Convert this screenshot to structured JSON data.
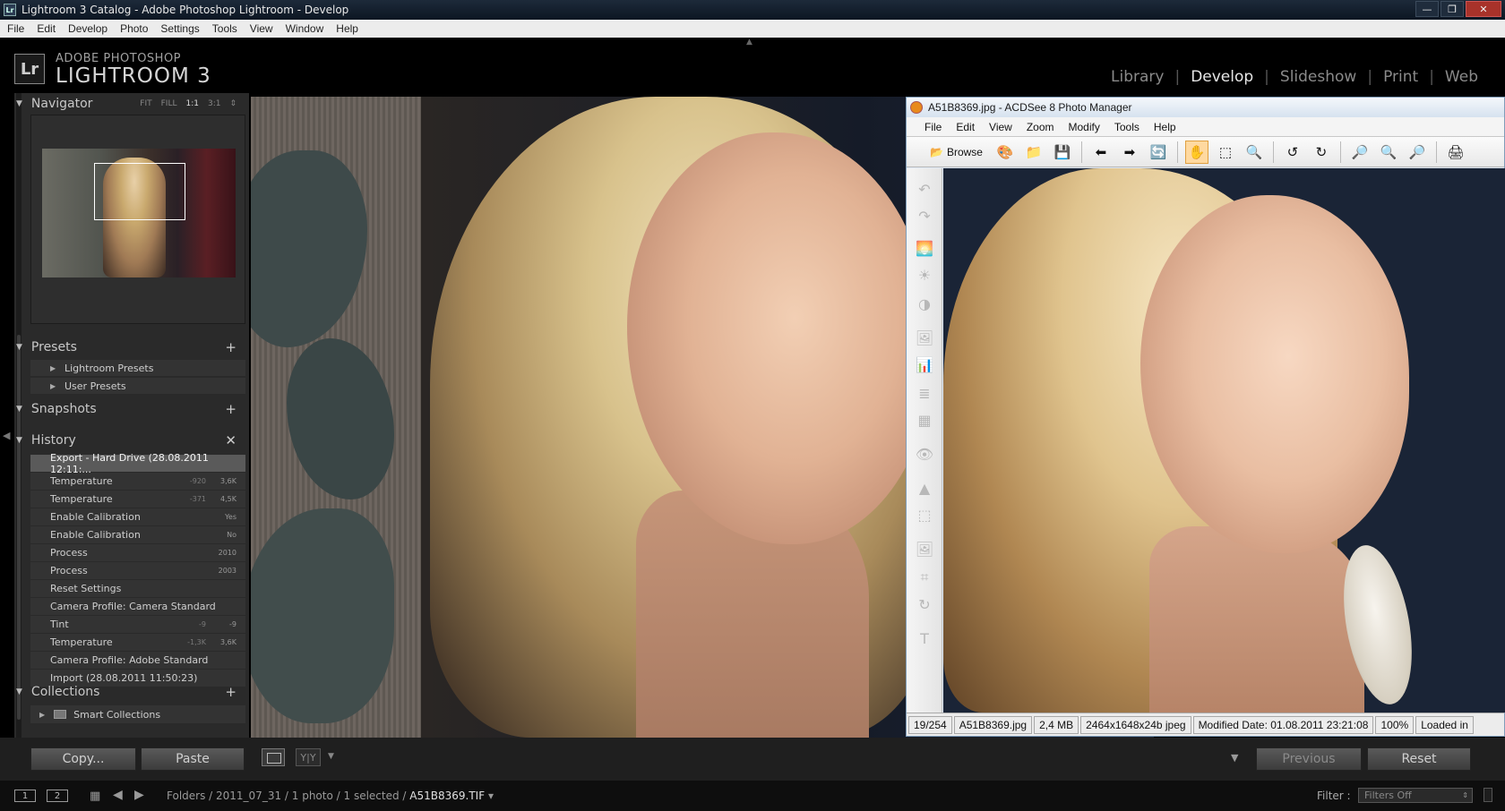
{
  "window": {
    "title": "Lightroom 3 Catalog - Adobe Photoshop Lightroom - Develop",
    "icon_text": "Lr",
    "minimize": "—",
    "maximize": "❐",
    "close": "✕"
  },
  "menu": [
    "File",
    "Edit",
    "Develop",
    "Photo",
    "Settings",
    "Tools",
    "View",
    "Window",
    "Help"
  ],
  "brand": {
    "logo": "Lr",
    "line1": "ADOBE PHOTOSHOP",
    "line2": "LIGHTROOM 3"
  },
  "modules": {
    "items": [
      "Library",
      "Develop",
      "Slideshow",
      "Print",
      "Web"
    ],
    "active": "Develop",
    "separator": "|"
  },
  "navigator": {
    "title": "Navigator",
    "options": [
      "FIT",
      "FILL",
      "1:1",
      "3:1"
    ],
    "selected": "1:1",
    "more": "⇕"
  },
  "presets": {
    "title": "Presets",
    "add": "+",
    "items": [
      "Lightroom Presets",
      "User Presets"
    ]
  },
  "snapshots": {
    "title": "Snapshots",
    "add": "+"
  },
  "history": {
    "title": "History",
    "clear": "✕",
    "items": [
      {
        "label": "Export - Hard Drive (28.08.2011 12:11:...",
        "before": "",
        "after": ""
      },
      {
        "label": "Temperature",
        "before": "-920",
        "after": "3,6K"
      },
      {
        "label": "Temperature",
        "before": "-371",
        "after": "4,5K"
      },
      {
        "label": "Enable Calibration",
        "before": "",
        "after": "Yes"
      },
      {
        "label": "Enable Calibration",
        "before": "",
        "after": "No"
      },
      {
        "label": "Process",
        "before": "",
        "after": "2010"
      },
      {
        "label": "Process",
        "before": "",
        "after": "2003"
      },
      {
        "label": "Reset Settings",
        "before": "",
        "after": ""
      },
      {
        "label": "Camera Profile: Camera Standard",
        "before": "",
        "after": ""
      },
      {
        "label": "Tint",
        "before": "-9",
        "after": "-9"
      },
      {
        "label": "Temperature",
        "before": "-1,3K",
        "after": "3,6K"
      },
      {
        "label": "Camera Profile: Adobe Standard",
        "before": "",
        "after": ""
      },
      {
        "label": "Import (28.08.2011 11:50:23)",
        "before": "",
        "after": ""
      }
    ],
    "selected_index": 0
  },
  "collections": {
    "title": "Collections",
    "add": "+",
    "items": [
      "Smart Collections"
    ]
  },
  "bottom": {
    "copy": "Copy...",
    "paste": "Paste",
    "previous": "Previous",
    "reset": "Reset",
    "yy": "Y|Y"
  },
  "filmstrip": {
    "screens": [
      "1",
      "2"
    ],
    "path": "Folders / 2011_07_31 / 1 photo / 1 selected / ",
    "filename": "A51B8369.TIF",
    "filename_caret": "▾",
    "filter_label": "Filter :",
    "filter_value": "Filters Off"
  },
  "acdsee": {
    "title": "A51B8369.jpg - ACDSee 8 Photo Manager",
    "menu": [
      "File",
      "Edit",
      "View",
      "Zoom",
      "Modify",
      "Tools",
      "Help"
    ],
    "browse": "Browse",
    "status": [
      "19/254",
      "A51B8369.jpg",
      "2,4 MB",
      "2464x1648x24b jpeg",
      "Modified Date: 01.08.2011 23:21:08",
      "100%",
      "Loaded in"
    ]
  },
  "colors": {
    "accent_select": "#5a5a5a",
    "acdsee_pressed": "#ffd9a0",
    "acdsee_title": "#d6e2ef"
  }
}
